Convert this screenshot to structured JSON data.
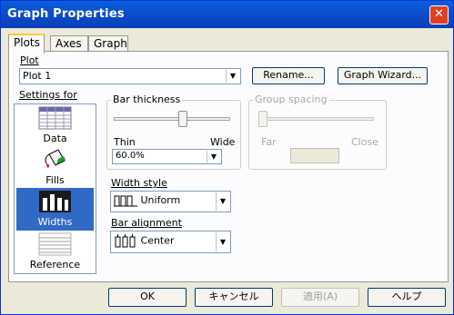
{
  "window": {
    "title": "Graph Properties"
  },
  "tabs": [
    {
      "label": "Plots"
    },
    {
      "label": "Axes"
    },
    {
      "label": "Graph"
    }
  ],
  "plot": {
    "label": "Plot",
    "selected": "Plot 1",
    "rename_label": "Rename...",
    "graph_wizard_label": "Graph Wizard..."
  },
  "settings": {
    "label": "Settings for",
    "items": [
      {
        "label": "Data",
        "icon": "data-icon"
      },
      {
        "label": "Fills",
        "icon": "paint-bucket-icon"
      },
      {
        "label": "Widths",
        "icon": "bar-chart-icon",
        "selected": true
      },
      {
        "label": "Reference",
        "icon": "reference-lines-icon"
      }
    ]
  },
  "bar_thickness": {
    "title": "Bar thickness",
    "min_label": "Thin",
    "max_label": "Wide",
    "value_text": "60.0%",
    "value": 0.6
  },
  "group_spacing": {
    "title": "Group spacing",
    "min_label": "Far",
    "max_label": "Close",
    "value_text": ""
  },
  "width_style": {
    "label": "Width style",
    "selected": "Uniform"
  },
  "bar_alignment": {
    "label": "Bar alignment",
    "selected": "Center"
  },
  "footer": {
    "ok": "OK",
    "cancel": "キャンセル",
    "apply": "適用(A)",
    "help": "ヘルプ"
  },
  "colors": {
    "title_bar": "#0b4fd0",
    "selection": "#316ac5"
  }
}
